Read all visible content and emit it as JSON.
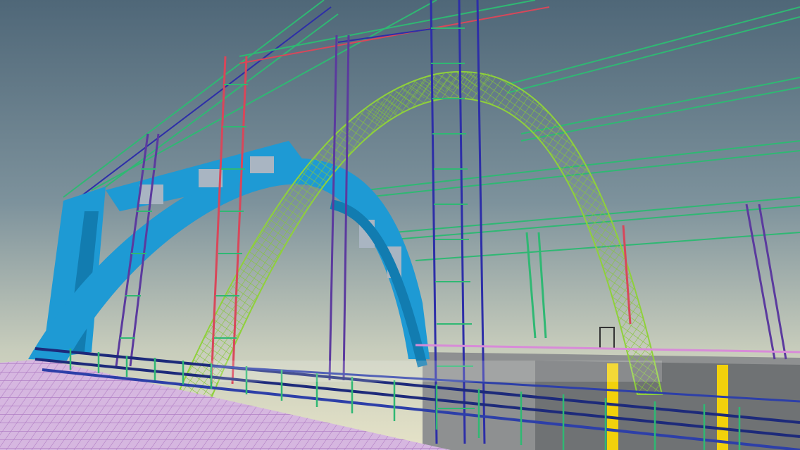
{
  "scene": {
    "subject": "bim-rebar-model",
    "colors": {
      "sky_top": "#4f6778",
      "sky_mid": "#7d929c",
      "sky_horizon": "#d9ddc6",
      "concrete_arch": "#1e9ad4",
      "arch_shadow": "#127cb0",
      "rebar_green": "#2fb873",
      "rebar_lime": "#8fd13a",
      "rebar_blue": "#2d2ea8",
      "rebar_purple": "#5b3a9e",
      "rebar_red": "#d8475a",
      "rebar_pink": "#d88bd8",
      "deck_slab": "#c9a6d6",
      "parapet_navy": "#1d2a7a",
      "wall_grey": "#7f8183",
      "marker_yellow": "#f2d10b"
    }
  }
}
